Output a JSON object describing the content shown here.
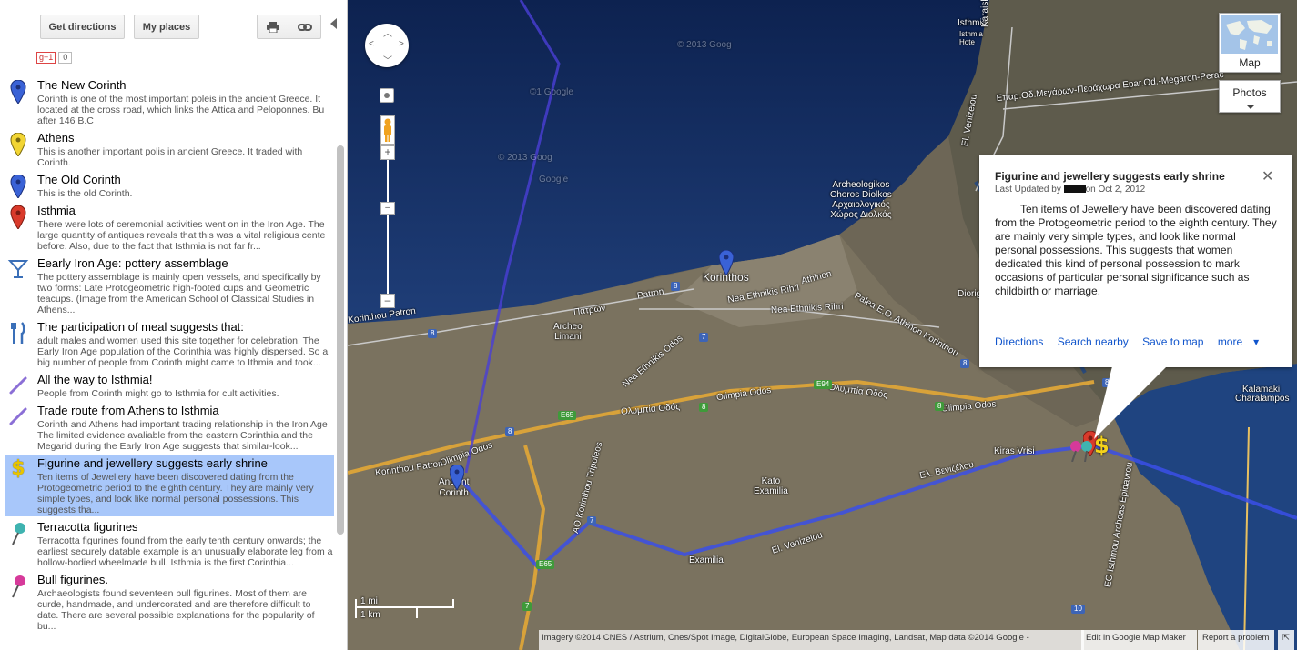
{
  "toolbar": {
    "directions_label": "Get directions",
    "places_label": "My places",
    "print_icon": "printer-icon",
    "link_icon": "link-icon"
  },
  "gplus": {
    "label": "g+1",
    "count": "0"
  },
  "places": [
    {
      "title": "The New Corinth",
      "icon": "blue-pin-icon",
      "color": "#3a62d6",
      "desc": "Corinth is one of the most important poleis in the ancient Greece. It located at the cross road, which links the Attica and Peloponnes. Bu after 146 B.C"
    },
    {
      "title": "Athens",
      "icon": "yellow-pin-icon",
      "color": "#f2d534",
      "desc": "This is another important polis in ancient Greece. It traded with Corinth."
    },
    {
      "title": "The Old Corinth",
      "icon": "blue-pin-icon",
      "color": "#3a62d6",
      "desc": "This is the old Corinth."
    },
    {
      "title": "Isthmia",
      "icon": "red-pin-icon",
      "color": "#d93a2b",
      "desc": "There were lots of ceremonial activities went on in the Iron Age. The large quantity of antiques reveals that this was a vital religious cente before. Also, due to the fact that Isthmia is not far fr..."
    },
    {
      "title": "Eearly Iron Age: pottery assemblage",
      "icon": "cocktail-glass-icon",
      "color": "#3a6fb8",
      "desc": "The pottery assemblage is mainly open vessels, and specifically by two forms: Late Protogeometric high-footed cups and Geometric teacups. (Image from the American School of Classical Studies in Athens..."
    },
    {
      "title": "The participation of meal suggests that:",
      "icon": "fork-knife-icon",
      "color": "#3a6fb8",
      "desc": "adult males and women used this site together for celebration. The Early Iron Age population of the Corinthia was highly dispersed. So a big number of people from Corinth might came to Ithmia and took..."
    },
    {
      "title": "All the way to Isthmia!",
      "icon": "purple-line-icon",
      "color": "#8b6fd6",
      "desc": "People from Corinth might go to Isthmia for cult activities."
    },
    {
      "title": "Trade route from Athens to Isthmia",
      "icon": "purple-line-icon",
      "color": "#8b6fd6",
      "desc": "Corinth and Athens had important trading relationship in the Iron Age    The limited evidence avaliable from the eastern Corinthia and the Megarid during the Early Iron Age suggests that similar-look..."
    },
    {
      "title": "Figurine and jewellery suggests early shrine",
      "icon": "dollar-sign-icon",
      "color": "#e8c400",
      "desc": "Ten items of Jewellery have been discovered dating from the Protogeometric period to the eighth century. They are mainly very simple types, and look like normal personal possessions. This suggests tha..."
    },
    {
      "title": "Terracotta figurines",
      "icon": "teal-pushpin-icon",
      "color": "#3fb3b0",
      "desc": "Terracotta figurines found from the early tenth century onwards; the earliest securely datable example is an unusually elaborate leg from a hollow-bodied wheelmade bull. Isthmia is the first Corinthia..."
    },
    {
      "title": "Bull figurines.",
      "icon": "pink-pushpin-icon",
      "color": "#d63a9a",
      "desc": "Archaeologists found  seventeen bull figurines. Most of them are curde, handmade, and undercorated and are therefore difficult to date. There are several possible explanations for the popularity of bu..."
    }
  ],
  "selected_index": 8,
  "map": {
    "labels": {
      "isthmia_top": "Isthmia",
      "isthmia_hotel": "Isthmia\nHote",
      "karaiskaki": "Karaiskaki",
      "epar_odos": "Επαρ.Οδ.Μεγάρων-Περάχωρα    Epar.Od.-Megaron-Perac",
      "el_venizelou_n": "El. Venizelou",
      "archeologikos": "Archeologikos\nChoros Diolkos\nΑρχαιολογικός\nΧώρος Διολκός",
      "korinthos": "Korinthos",
      "athinon": "Athinon",
      "patron": "Patron",
      "patron_gr": "Πατρών",
      "nea_ethnikis": "Nea Ethnikis Rihri",
      "nea_ethnikis2": "Nea Ethnikis Rihri",
      "palea_eo": "Palea E.O. Athinon Korinthou",
      "diorigos": "Diorigo",
      "korinthou_patron": "Korinthou Patron",
      "korinthou_patron2": "Korinthou Patron",
      "archeo_limani": "Archeo\nLimani",
      "nea_ethnikis_odos": "Nea Ethnikis Odos",
      "olimpia_odos": "Olimpia Odos",
      "olympia_gr": "Ολυμπία Οδός",
      "olympia_gr2": "Ολυμπία Οδός",
      "olimpia_odos_e": "Olimpia Odos",
      "ao_korinthou": "AO Korinthou Tripoleos",
      "ancient_corinth": "Ancient\nCorinth",
      "kato_examilia": "Kato\nExamilia",
      "kiras_vrisi": "Kiras Vrisi",
      "el_venizelou": "El. Venizelou",
      "el_venizelou_gr": "Ελ. Βενιζέλου",
      "examilia": "Examilia",
      "eo_isthmou": "EO Isthmou Archeas Epidavrou",
      "kalamaki": "Kalamaki",
      "charalampos": "Charalampos",
      "watermark1": "© 2013 Goog",
      "watermark2": "©1 Google",
      "watermark3": "© 2013 Goog",
      "watermark4": "Google"
    },
    "shields": {
      "s8a": "8",
      "s8b": "8",
      "s8c": "8",
      "s8d": "8",
      "s8e": "8",
      "s8f": "8",
      "s7a": "7",
      "s7b": "7",
      "s7c": "7",
      "e65a": "E65",
      "e65b": "E65",
      "e94": "E94",
      "s10": "10"
    }
  },
  "map_type": {
    "map_label": "Map",
    "photos_label": "Photos"
  },
  "info_window": {
    "title": "Figurine and jewellery suggests early shrine",
    "meta_prefix": "Last Updated by",
    "meta_suffix": "on Oct 2, 2012",
    "body": "Ten items of Jewellery have been discovered dating from the Protogeometric period to the eighth century. They are mainly very simple types, and look like normal personal possessions. This suggests that women dedicated this kind of personal possession to mark occasions of particular personal significance such as childbirth or marriage.",
    "links": {
      "directions": "Directions",
      "search": "Search nearby",
      "save": "Save to map",
      "more": "more"
    }
  },
  "scale": {
    "mi": "1 mi",
    "km": "1 km"
  },
  "footer": {
    "attribution": "Imagery ©2014 CNES / Astrium, Cnes/Spot Image, DigitalGlobe, European Space Imaging, Landsat, Map data ©2014 Google -",
    "edit": "Edit in Google Map Maker",
    "report": "Report a problem"
  }
}
